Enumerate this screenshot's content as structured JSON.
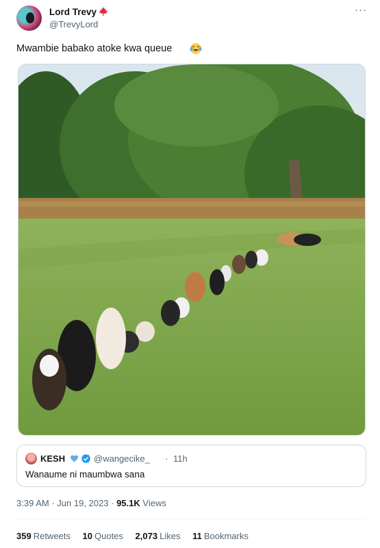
{
  "author": {
    "name": "Lord Trevy",
    "handle": "@TrevyLord",
    "flag_icon": "canada-flag-icon"
  },
  "tweet": {
    "text": "Mwambie babako atoke kwa queue",
    "emoji_icon": "tears-of-joy-emoji-icon",
    "image_icon": "dogs-in-queue-photo"
  },
  "more_label": "···",
  "quote": {
    "name": "KESH",
    "handle": "@wangecike_",
    "separator": "·",
    "time": "11h",
    "text": "Wanaume ni maumbwa sana",
    "badges": [
      "blue-heart-icon",
      "verified-badge-icon"
    ]
  },
  "meta": {
    "time": "3:39 AM",
    "sep1": "·",
    "date": "Jun 19, 2023",
    "sep2": "·",
    "views_count": "95.1K",
    "views_label": "Views"
  },
  "stats": [
    {
      "count": "359",
      "label": "Retweets"
    },
    {
      "count": "10",
      "label": "Quotes"
    },
    {
      "count": "2,073",
      "label": "Likes"
    },
    {
      "count": "11",
      "label": "Bookmarks"
    }
  ],
  "colors": {
    "text": "#0f1419",
    "secondary": "#536471",
    "border": "#cfd9de",
    "verified": "#1d9bf0",
    "flag_red": "#e0243a"
  }
}
